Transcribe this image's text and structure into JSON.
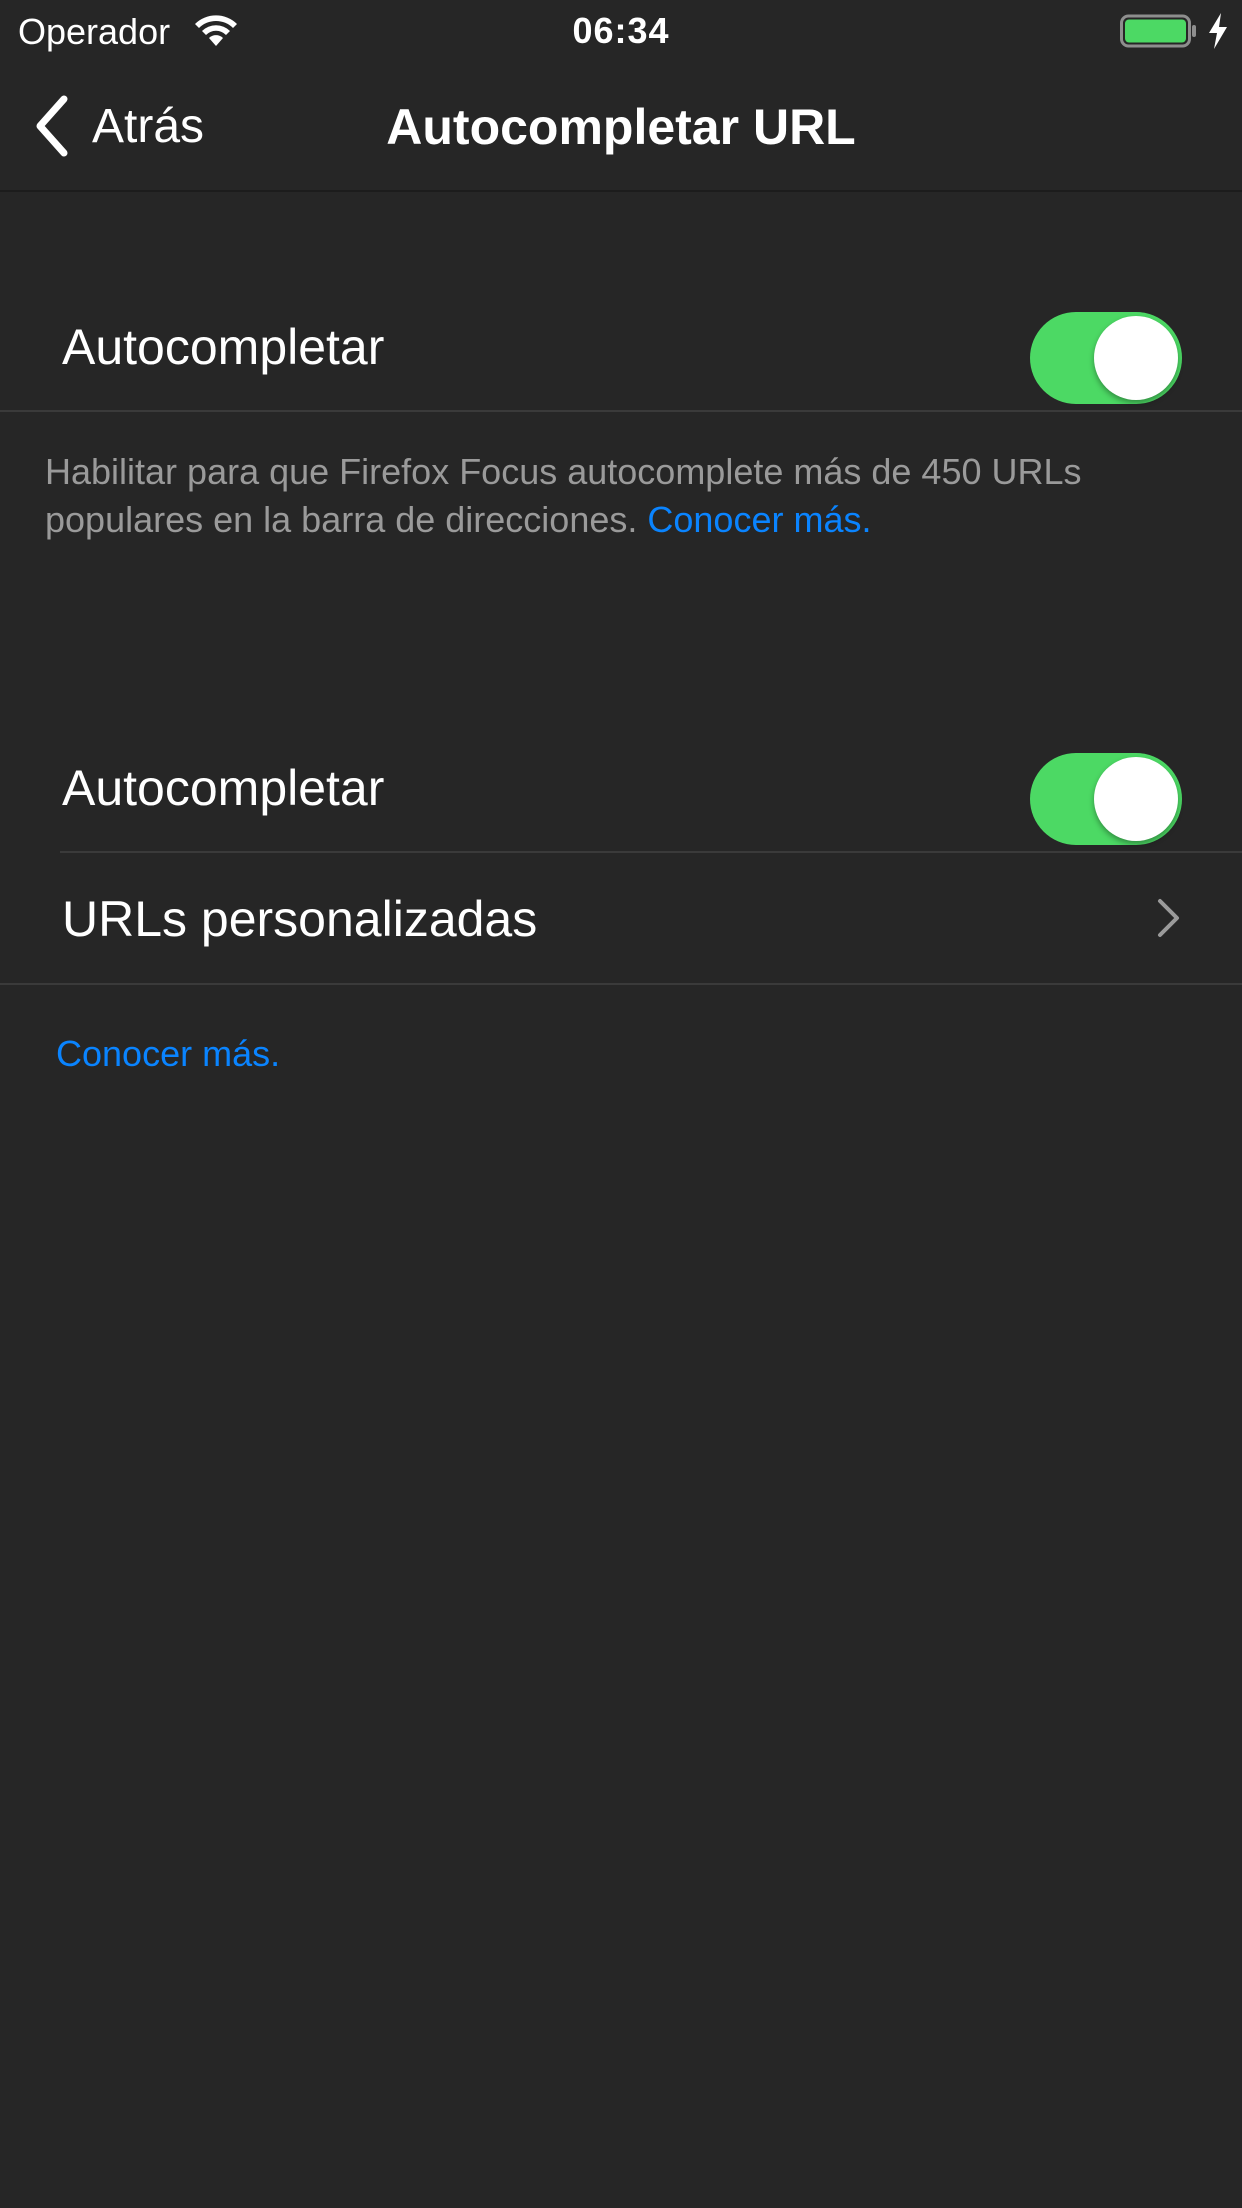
{
  "status_bar": {
    "carrier": "Operador",
    "time": "06:34",
    "icons": [
      "wifi-icon",
      "battery-icon",
      "charging-icon"
    ],
    "battery_color": "#4cd964"
  },
  "nav": {
    "back_label": "Atrás",
    "title": "Autocompletar URL"
  },
  "section1": {
    "toggle_label": "Autocompletar",
    "toggle_on": true,
    "footer_text": "Habilitar para que Firefox Focus autocomplete más de 450 URLs populares en la barra de direcciones.",
    "footer_link": "Conocer más."
  },
  "section2": {
    "toggle_label": "Autocompletar",
    "toggle_on": true,
    "custom_urls_label": "URLs personalizadas",
    "footer_link": "Conocer más."
  },
  "colors": {
    "background": "#262626",
    "toggle_on": "#4cd964",
    "link": "#0a84ff",
    "footer_text": "#9a9a9a"
  }
}
